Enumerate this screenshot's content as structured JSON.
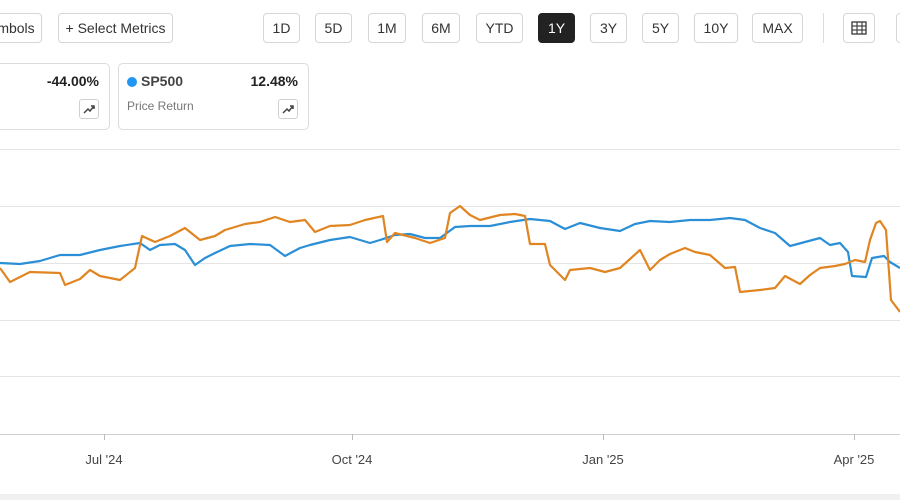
{
  "toolbar": {
    "compare_symbols_label": "mbols",
    "select_metrics_label": "+ Select Metrics",
    "ranges": [
      "1D",
      "5D",
      "1M",
      "6M",
      "YTD",
      "1Y",
      "3Y",
      "5Y",
      "10Y",
      "MAX"
    ],
    "active_range": "1Y"
  },
  "cards": [
    {
      "value": "-44.00%",
      "color": "#e8862a"
    },
    {
      "symbol": "SP500",
      "subtitle": "Price Return",
      "value": "12.48%",
      "color": "#2196f3"
    }
  ],
  "icons": [
    "table-icon",
    "trend-icon"
  ],
  "chart_data": {
    "type": "line",
    "x_tick_labels": [
      "Jul '24",
      "Oct '24",
      "Jan '25",
      "Apr '25"
    ],
    "series": [
      {
        "color": "#2a8fd6",
        "points": [
          [
            0,
            263
          ],
          [
            20,
            264
          ],
          [
            40,
            261
          ],
          [
            60,
            255
          ],
          [
            80,
            255
          ],
          [
            100,
            250
          ],
          [
            120,
            246
          ],
          [
            140,
            243
          ],
          [
            150,
            250
          ],
          [
            160,
            245
          ],
          [
            175,
            244
          ],
          [
            185,
            250
          ],
          [
            195,
            265
          ],
          [
            205,
            258
          ],
          [
            215,
            253
          ],
          [
            230,
            246
          ],
          [
            250,
            244
          ],
          [
            270,
            245
          ],
          [
            285,
            256
          ],
          [
            300,
            248
          ],
          [
            310,
            245
          ],
          [
            330,
            240
          ],
          [
            350,
            237
          ],
          [
            370,
            243
          ],
          [
            380,
            240
          ],
          [
            395,
            235
          ],
          [
            410,
            234
          ],
          [
            425,
            238
          ],
          [
            440,
            238
          ],
          [
            455,
            227
          ],
          [
            470,
            226
          ],
          [
            490,
            226
          ],
          [
            510,
            222
          ],
          [
            530,
            219
          ],
          [
            550,
            221
          ],
          [
            565,
            229
          ],
          [
            580,
            223
          ],
          [
            600,
            228
          ],
          [
            620,
            231
          ],
          [
            635,
            224
          ],
          [
            650,
            221
          ],
          [
            670,
            222
          ],
          [
            690,
            220
          ],
          [
            710,
            220
          ],
          [
            730,
            218
          ],
          [
            745,
            220
          ],
          [
            760,
            228
          ],
          [
            775,
            233
          ],
          [
            790,
            246
          ],
          [
            805,
            242
          ],
          [
            820,
            238
          ],
          [
            830,
            245
          ],
          [
            840,
            243
          ],
          [
            848,
            252
          ],
          [
            852,
            276
          ],
          [
            866,
            277
          ],
          [
            872,
            258
          ],
          [
            884,
            256
          ],
          [
            890,
            262
          ],
          [
            900,
            268
          ]
        ]
      },
      {
        "color": "#e08521",
        "points": [
          [
            0,
            268
          ],
          [
            10,
            282
          ],
          [
            30,
            272
          ],
          [
            60,
            273
          ],
          [
            65,
            285
          ],
          [
            80,
            279
          ],
          [
            90,
            270
          ],
          [
            100,
            276
          ],
          [
            120,
            280
          ],
          [
            135,
            268
          ],
          [
            142,
            236
          ],
          [
            155,
            242
          ],
          [
            170,
            236
          ],
          [
            185,
            228
          ],
          [
            200,
            240
          ],
          [
            215,
            236
          ],
          [
            225,
            230
          ],
          [
            245,
            224
          ],
          [
            260,
            222
          ],
          [
            275,
            217
          ],
          [
            290,
            222
          ],
          [
            305,
            220
          ],
          [
            315,
            232
          ],
          [
            330,
            226
          ],
          [
            350,
            225
          ],
          [
            365,
            220
          ],
          [
            383,
            216
          ],
          [
            387,
            242
          ],
          [
            395,
            233
          ],
          [
            415,
            238
          ],
          [
            430,
            243
          ],
          [
            445,
            238
          ],
          [
            450,
            213
          ],
          [
            460,
            206
          ],
          [
            470,
            215
          ],
          [
            480,
            220
          ],
          [
            500,
            215
          ],
          [
            515,
            214
          ],
          [
            525,
            216
          ],
          [
            530,
            244
          ],
          [
            545,
            244
          ],
          [
            550,
            265
          ],
          [
            565,
            280
          ],
          [
            570,
            270
          ],
          [
            590,
            268
          ],
          [
            605,
            272
          ],
          [
            620,
            268
          ],
          [
            640,
            250
          ],
          [
            650,
            270
          ],
          [
            660,
            260
          ],
          [
            670,
            254
          ],
          [
            685,
            248
          ],
          [
            695,
            252
          ],
          [
            710,
            255
          ],
          [
            725,
            268
          ],
          [
            735,
            267
          ],
          [
            740,
            292
          ],
          [
            760,
            290
          ],
          [
            775,
            288
          ],
          [
            785,
            276
          ],
          [
            800,
            284
          ],
          [
            810,
            275
          ],
          [
            820,
            268
          ],
          [
            835,
            266
          ],
          [
            845,
            264
          ],
          [
            855,
            260
          ],
          [
            865,
            262
          ],
          [
            870,
            240
          ],
          [
            876,
            223
          ],
          [
            880,
            221
          ],
          [
            886,
            230
          ],
          [
            891,
            300
          ],
          [
            900,
            312
          ]
        ]
      }
    ]
  }
}
